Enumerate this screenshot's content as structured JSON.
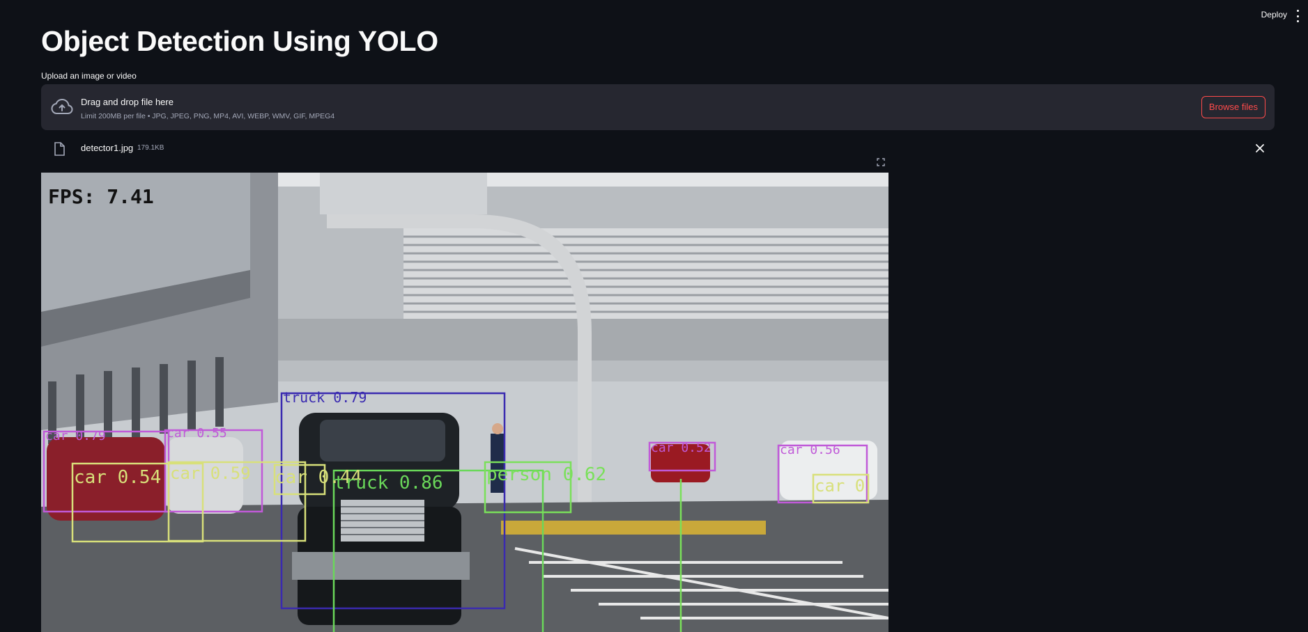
{
  "header": {
    "deploy_label": "Deploy",
    "menu_icon": "more-vertical-icon"
  },
  "page": {
    "title": "Object Detection Using YOLO"
  },
  "uploader": {
    "label": "Upload an image or video",
    "drop_title": "Drag and drop file here",
    "limit_text": "Limit 200MB per file • JPG, JPEG, PNG, MP4, AVI, WEBP, WMV, GIF, MPEG4",
    "browse_label": "Browse files",
    "icon": "cloud-upload-icon"
  },
  "uploaded_file": {
    "name": "detector1.jpg",
    "size": "179.1KB",
    "icon": "file-icon",
    "remove_icon": "close-icon"
  },
  "image": {
    "fps_text": "FPS: 7.41",
    "detections": [
      {
        "label": "truck 0.79"
      },
      {
        "label": "car 0.79"
      },
      {
        "label": "car 0.55"
      },
      {
        "label": "car 0.54"
      },
      {
        "label": "car 0.59"
      },
      {
        "label": "car 0.44"
      },
      {
        "label": "truck 0.86"
      },
      {
        "label": "person 0.62"
      },
      {
        "label": "car 0.52"
      },
      {
        "label": "car 0.56"
      },
      {
        "label": "car 0"
      }
    ],
    "colors": {
      "car": "#c05ad8",
      "car_alt": "#d8e07a",
      "truck": "#3a2ab0",
      "truck_alt": "#6ad85a",
      "person": "#7ae05a"
    }
  }
}
